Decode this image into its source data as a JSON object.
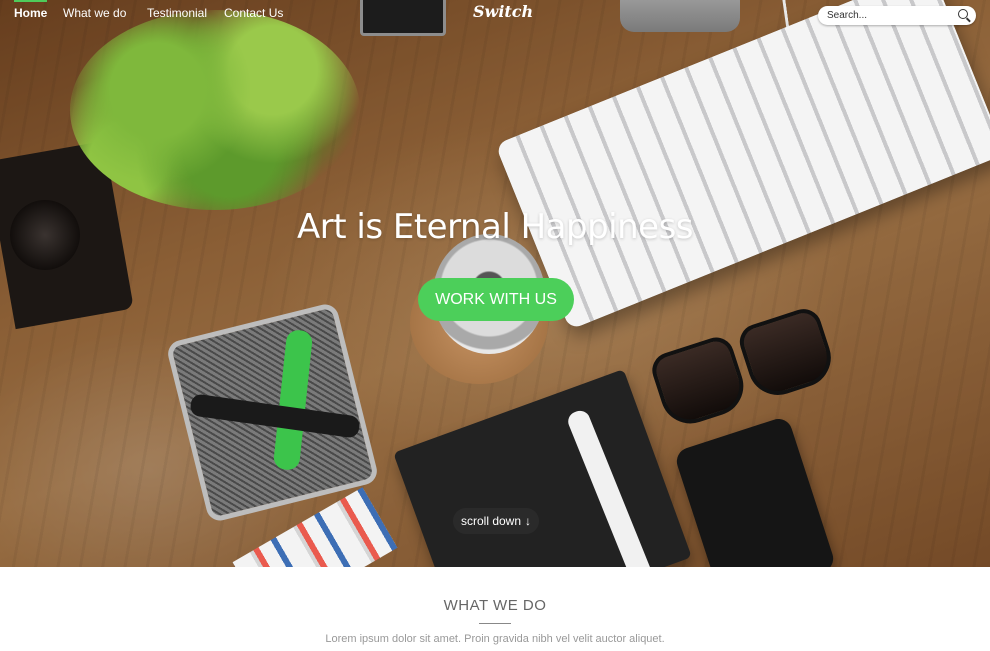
{
  "nav": {
    "items": [
      {
        "label": "Home",
        "active": true
      },
      {
        "label": "What we do"
      },
      {
        "label": "Testimonial"
      },
      {
        "label": "Contact Us"
      }
    ],
    "logo": "Switch",
    "search_placeholder": "Search..."
  },
  "hero": {
    "headline": "Art is Eternal Happiness",
    "cta_label": "WORK WITH US",
    "scroll_label": "scroll down",
    "scroll_icon": "arrow-down-icon"
  },
  "section": {
    "title": "WHAT WE DO",
    "text": "Lorem ipsum dolor sit amet. Proin gravida nibh vel velit auctor aliquet."
  },
  "colors": {
    "accent": "#4ccf5a"
  }
}
